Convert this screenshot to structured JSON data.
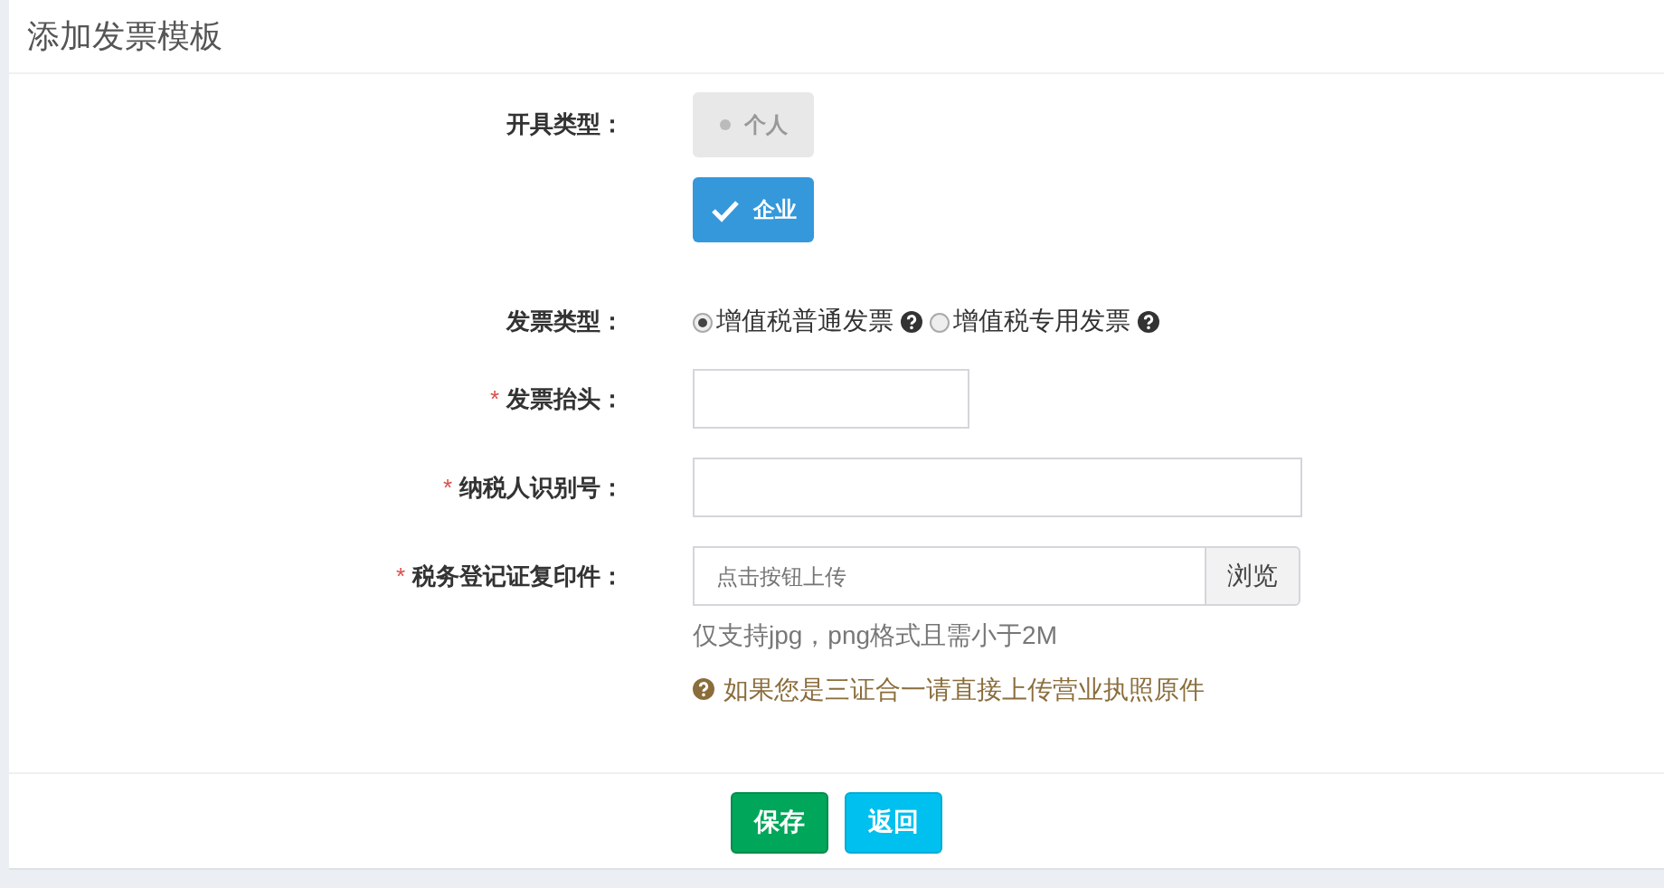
{
  "page": {
    "title": "添加发票模板"
  },
  "fields": [
    {
      "kind": "toggle",
      "label": "开具类型：",
      "options": [
        {
          "label": "个人",
          "selected": false
        },
        {
          "label": "企业",
          "selected": true
        }
      ]
    },
    {
      "kind": "radio",
      "label": "发票类型：",
      "options": [
        {
          "label": "增值税普通发票",
          "selected": true
        },
        {
          "label": "增值税专用发票",
          "selected": false
        }
      ]
    },
    {
      "kind": "short_text",
      "label": "发票抬头：",
      "required_mark": "*"
    },
    {
      "kind": "text",
      "label": "纳税人识别号：",
      "required_mark": "*"
    },
    {
      "kind": "file",
      "label": "税务登记证复印件：",
      "required_mark": "*",
      "placeholder": "点击按钮上传",
      "button": "浏览",
      "note": "仅支持jpg，png格式且需小于2M",
      "help": "如果您是三证合一请直接上传营业执照原件"
    }
  ],
  "buttons": [
    {
      "label": "保存",
      "kind": "primary"
    },
    {
      "label": "返回",
      "kind": "info"
    }
  ]
}
